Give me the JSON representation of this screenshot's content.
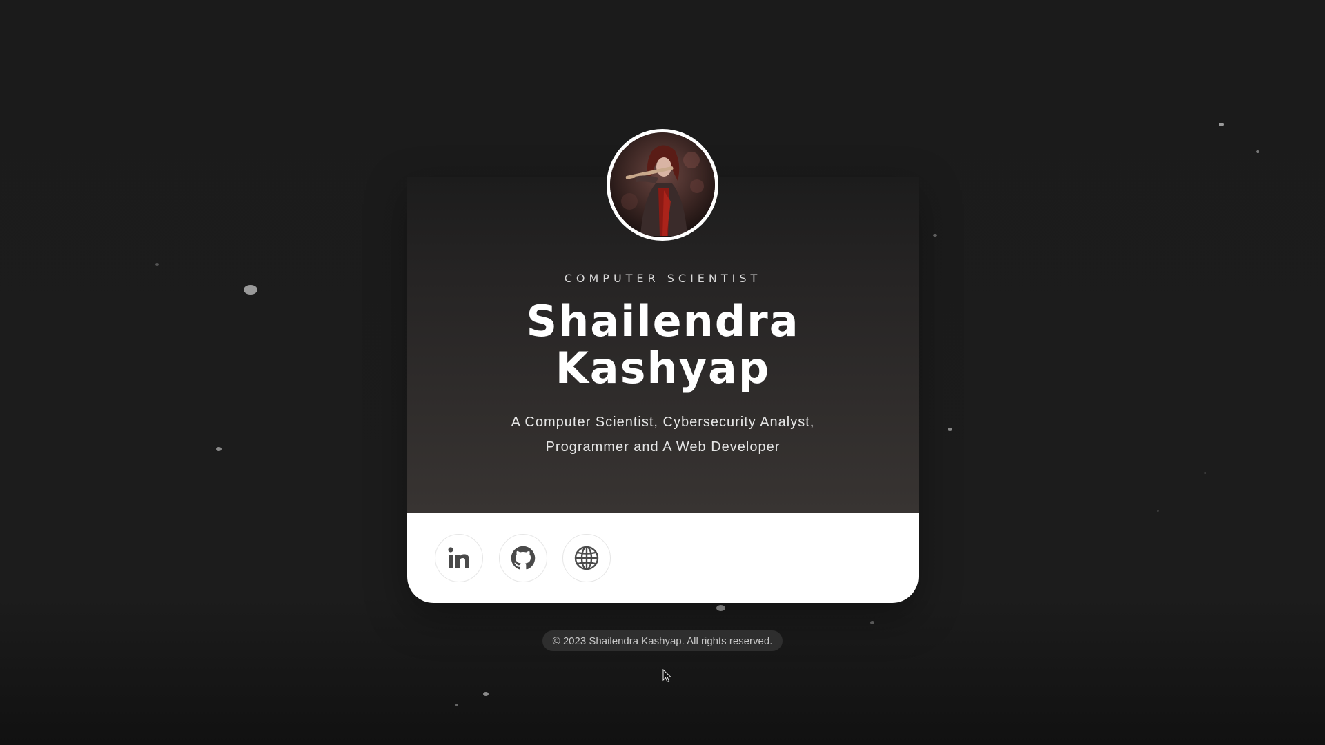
{
  "profile": {
    "subtitle": "COMPUTER SCIENTIST",
    "name_line1": "Shailendra",
    "name_line2": "Kashyap",
    "description_line1": "A Computer Scientist, Cybersecurity Analyst,",
    "description_line2": "Programmer and A Web Developer",
    "avatar_icon": "profile-avatar"
  },
  "social": [
    {
      "name": "linkedin",
      "icon": "linkedin-icon"
    },
    {
      "name": "github",
      "icon": "github-icon"
    },
    {
      "name": "website",
      "icon": "globe-icon"
    }
  ],
  "footer": {
    "copyright": "© 2023 Shailendra Kashyap. All rights reserved."
  },
  "colors": {
    "background": "#1b1b1b",
    "card_top": "#383432",
    "card_bottom": "#ffffff",
    "accent_red": "#8b1a14"
  }
}
